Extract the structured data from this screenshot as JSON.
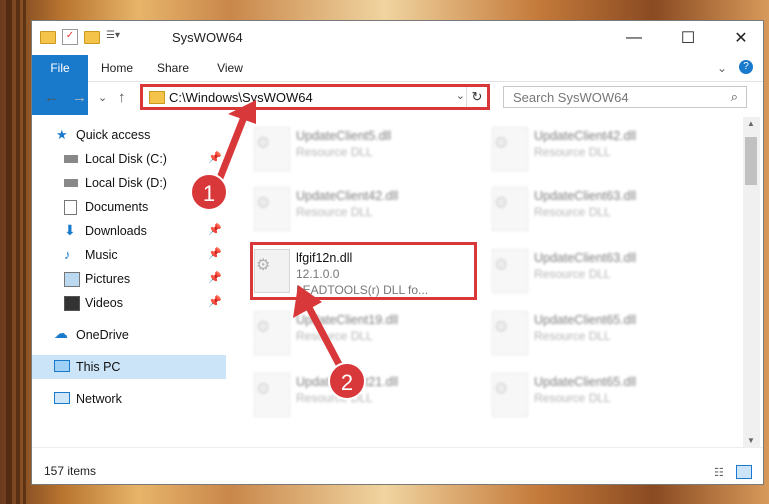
{
  "window": {
    "title": "SysWOW64",
    "min": "—",
    "max": "☐",
    "close": "✕"
  },
  "ribbon": {
    "tabs": [
      "File",
      "Home",
      "Share",
      "View"
    ],
    "expand": "⌄",
    "help": "?"
  },
  "address": {
    "path": "C:\\Windows\\SysWOW64",
    "refresh": "↻",
    "dropdown": "⌄"
  },
  "search": {
    "placeholder": "Search SysWOW64"
  },
  "nav": {
    "back": "←",
    "forward": "→",
    "recent": "⌄",
    "up": "↑"
  },
  "sidebar": [
    {
      "label": "Quick access",
      "pin": false
    },
    {
      "label": "Local Disk (C:)",
      "pin": true
    },
    {
      "label": "Local Disk (D:)",
      "pin": true
    },
    {
      "label": "Documents",
      "pin": true
    },
    {
      "label": "Downloads",
      "pin": true
    },
    {
      "label": "Music",
      "pin": true
    },
    {
      "label": "Pictures",
      "pin": true
    },
    {
      "label": "Videos",
      "pin": true
    },
    {
      "label": "OneDrive",
      "pin": false
    },
    {
      "label": "This PC",
      "pin": false
    },
    {
      "label": "Network",
      "pin": false
    }
  ],
  "files": {
    "left": [
      {
        "name": "UpdateClient5.dll",
        "type": "Resource DLL"
      },
      {
        "name": "UpdateClient42.dll",
        "type": "Resource DLL"
      },
      {
        "name": "lfgif12n.dll",
        "version": "12.1.0.0",
        "type": "LEADTOOLS(r) DLL fo..."
      },
      {
        "name": "UpdateClient19.dll",
        "type": "Resource DLL"
      },
      {
        "name": "UpdateClient21.dll",
        "type": "Resource DLL"
      }
    ],
    "right": [
      {
        "name": "UpdateClient42.dll",
        "type": "Resource DLL"
      },
      {
        "name": "UpdateClient63.dll",
        "type": "Resource DLL"
      },
      {
        "name": "UpdateClient63.dll",
        "type": "Resource DLL"
      },
      {
        "name": "UpdateClient65.dll",
        "type": "Resource DLL"
      },
      {
        "name": "UpdateClient65.dll",
        "type": "Resource DLL"
      }
    ]
  },
  "status": {
    "count": "157 items"
  },
  "annotations": {
    "badge1": "1",
    "badge2": "2"
  },
  "colors": {
    "accent": "#1979ca",
    "highlight": "#d9383a",
    "selection": "#cce4f7"
  }
}
